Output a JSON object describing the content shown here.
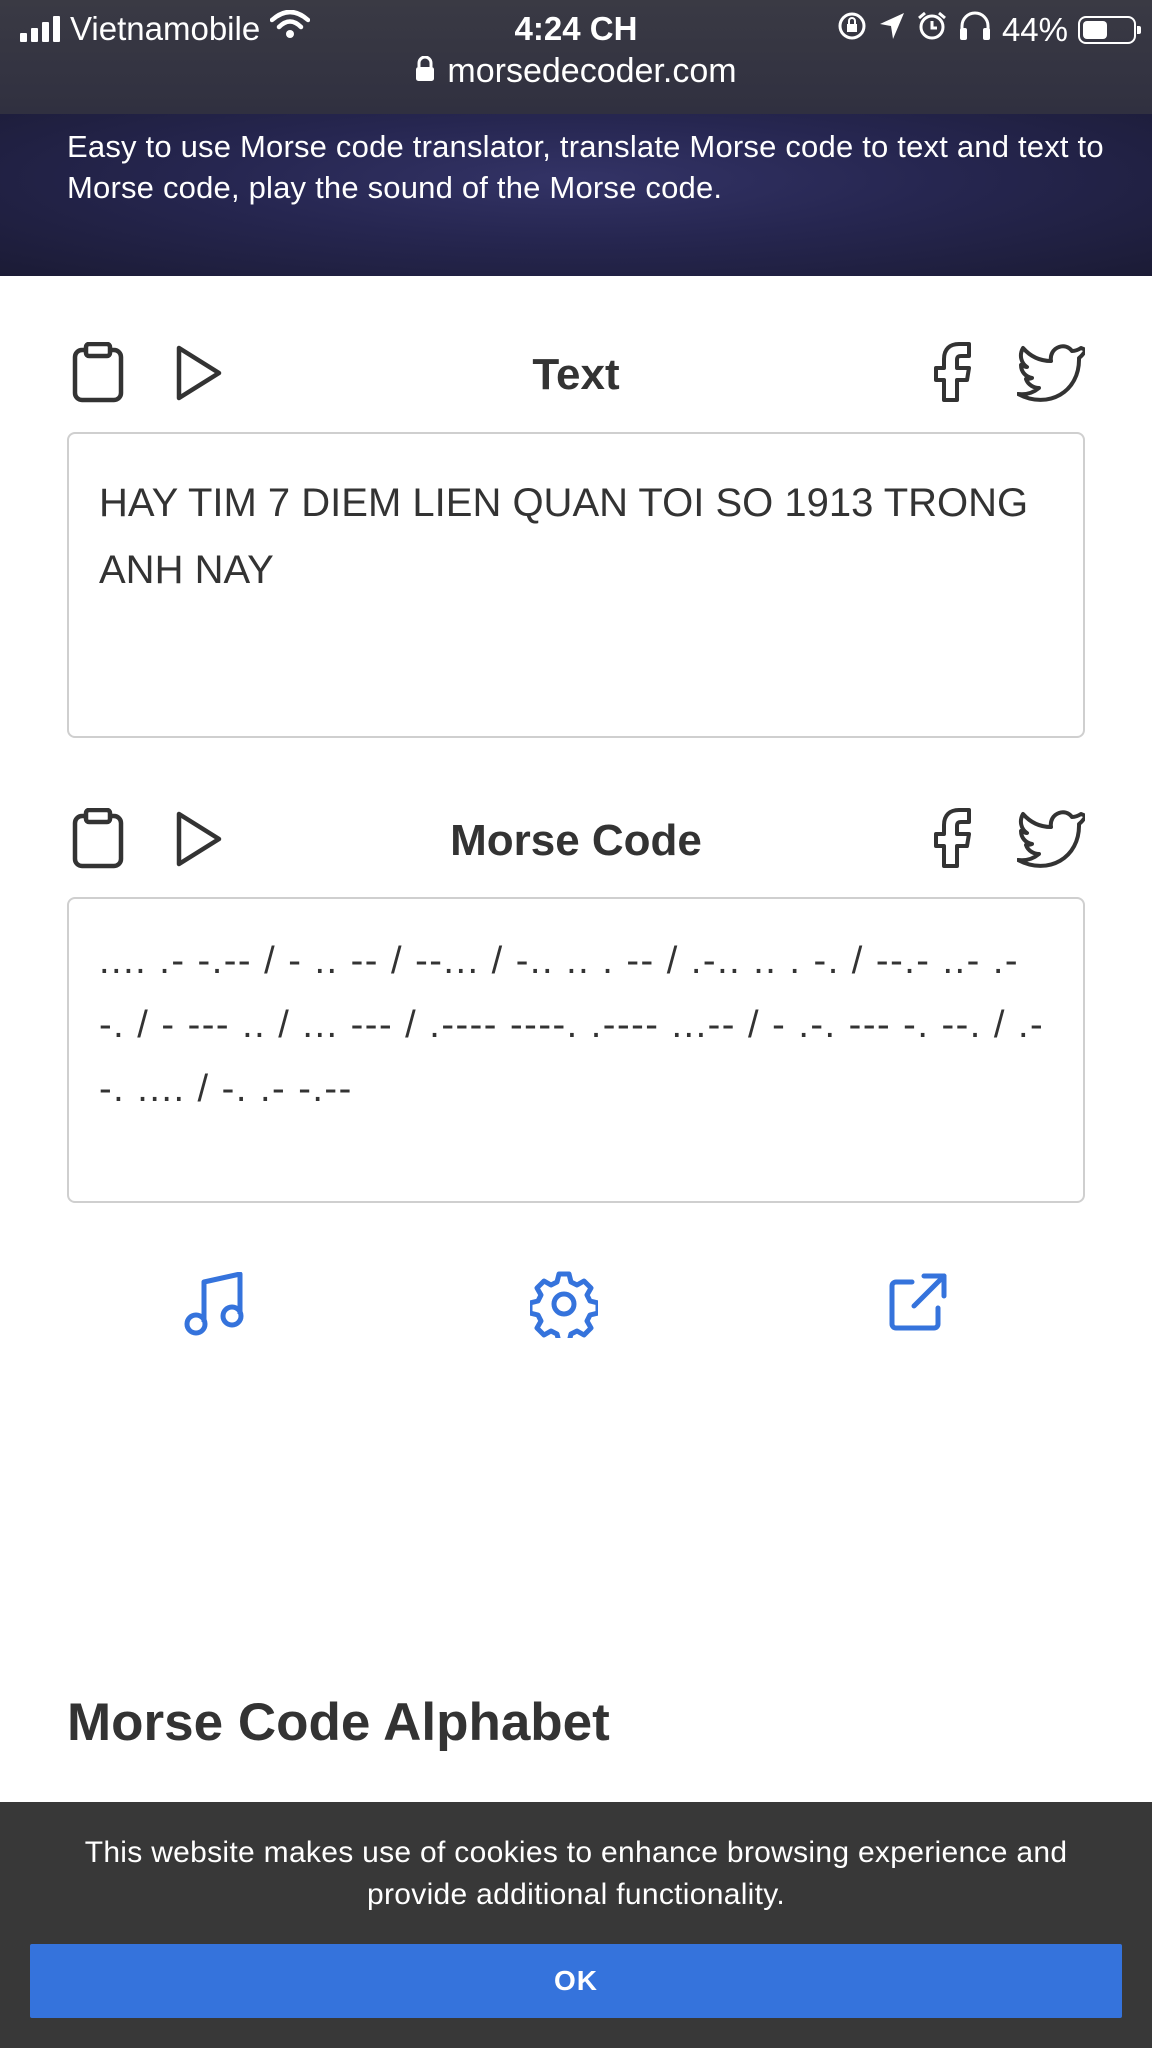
{
  "status_bar": {
    "carrier": "Vietnamobile",
    "time": "4:24 CH",
    "battery_percent": "44%",
    "battery_level": 0.44
  },
  "browser": {
    "url": "morsedecoder.com"
  },
  "hero": {
    "description": "Easy to use Morse code translator, translate Morse code to text and text to Morse code, play the sound of the Morse code."
  },
  "text_panel": {
    "title": "Text",
    "value": "HAY TIM 7 DIEM LIEN QUAN TOI SO 1913 TRONG ANH NAY"
  },
  "morse_panel": {
    "title": "Morse Code",
    "value": ".... .- -.-- / - .. -- / --... / -.. .. . -- / .-.. .. . -. / --.- ..- .- -. / - --- .. / ... --- / .---- ----. .---- ...-- / - .-. --- -. --. / .- -. .... / -. .- -.--"
  },
  "section": {
    "alphabet_title": "Morse Code Alphabet"
  },
  "cookie_banner": {
    "message": "This website makes use of cookies to enhance browsing experience and provide additional functionality.",
    "button_label": "OK"
  },
  "colors": {
    "accent_blue": "#3573dc",
    "hero_dark": "#262650",
    "icon_gray": "#333333",
    "banner_bg": "#383838"
  },
  "icons": [
    "signal-icon",
    "wifi-icon",
    "lock-icon",
    "orientation-lock-icon",
    "location-icon",
    "alarm-icon",
    "headphones-icon",
    "battery-icon",
    "clipboard-icon",
    "play-icon",
    "facebook-icon",
    "twitter-icon",
    "music-note-icon",
    "gear-icon",
    "external-link-icon"
  ]
}
